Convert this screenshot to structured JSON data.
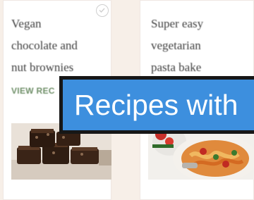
{
  "cards": [
    {
      "title_lines": [
        "Vegan",
        "chocolate and",
        "nut brownies"
      ],
      "link_label": "VIEW REC",
      "image_icon": "brownies-photo"
    },
    {
      "title_lines": [
        "Super easy",
        "vegetarian",
        "pasta bake"
      ],
      "image_icon": "pasta-bake-photo"
    }
  ],
  "banner": {
    "text": "Recipes with"
  },
  "colors": {
    "background": "#f7efe8",
    "card": "#ffffff",
    "link_green": "#6f8f68",
    "banner_blue": "#3d8fde",
    "banner_border": "#171717"
  }
}
